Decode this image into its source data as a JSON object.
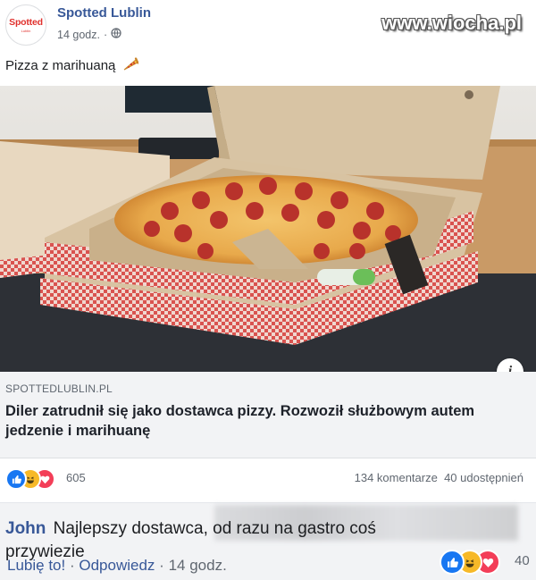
{
  "header": {
    "page_name": "Spotted Lublin",
    "avatar_text": "Spotted",
    "avatar_subtext": "Lublin",
    "time": "14 godz.",
    "separator": "·",
    "privacy_icon": "globe-icon"
  },
  "watermark": "www.wiocha.pl",
  "post": {
    "text": "Pizza z marihuaną",
    "emoji_icon": "pizza-icon"
  },
  "link": {
    "domain": "SPOTTEDLUBLIN.PL",
    "headline": "Diler zatrudnił się jako dostawca pizzy. Rozwoził służbowym autem jedzenie i marihuanę",
    "info_icon": "info-icon",
    "info_label": "i"
  },
  "reactions": {
    "icons": [
      "like-icon",
      "haha-icon",
      "love-icon"
    ],
    "count": "605",
    "comments": "134 komentarze",
    "shares": "40 udostępnień"
  },
  "comment": {
    "author": "John",
    "text": "Najlepszy dostawca, od razu na gastro coś przywiezie",
    "like_label": "Lubię to!",
    "reply_label": "Odpowiedz",
    "separator": "·",
    "time": "14 godz.",
    "reaction_count": "40"
  },
  "colors": {
    "facebook_blue": "#385898",
    "like_blue": "#1877f2",
    "love_red": "#f33e58",
    "haha_yellow": "#f7b928",
    "link_box_bg": "#f2f3f5"
  }
}
